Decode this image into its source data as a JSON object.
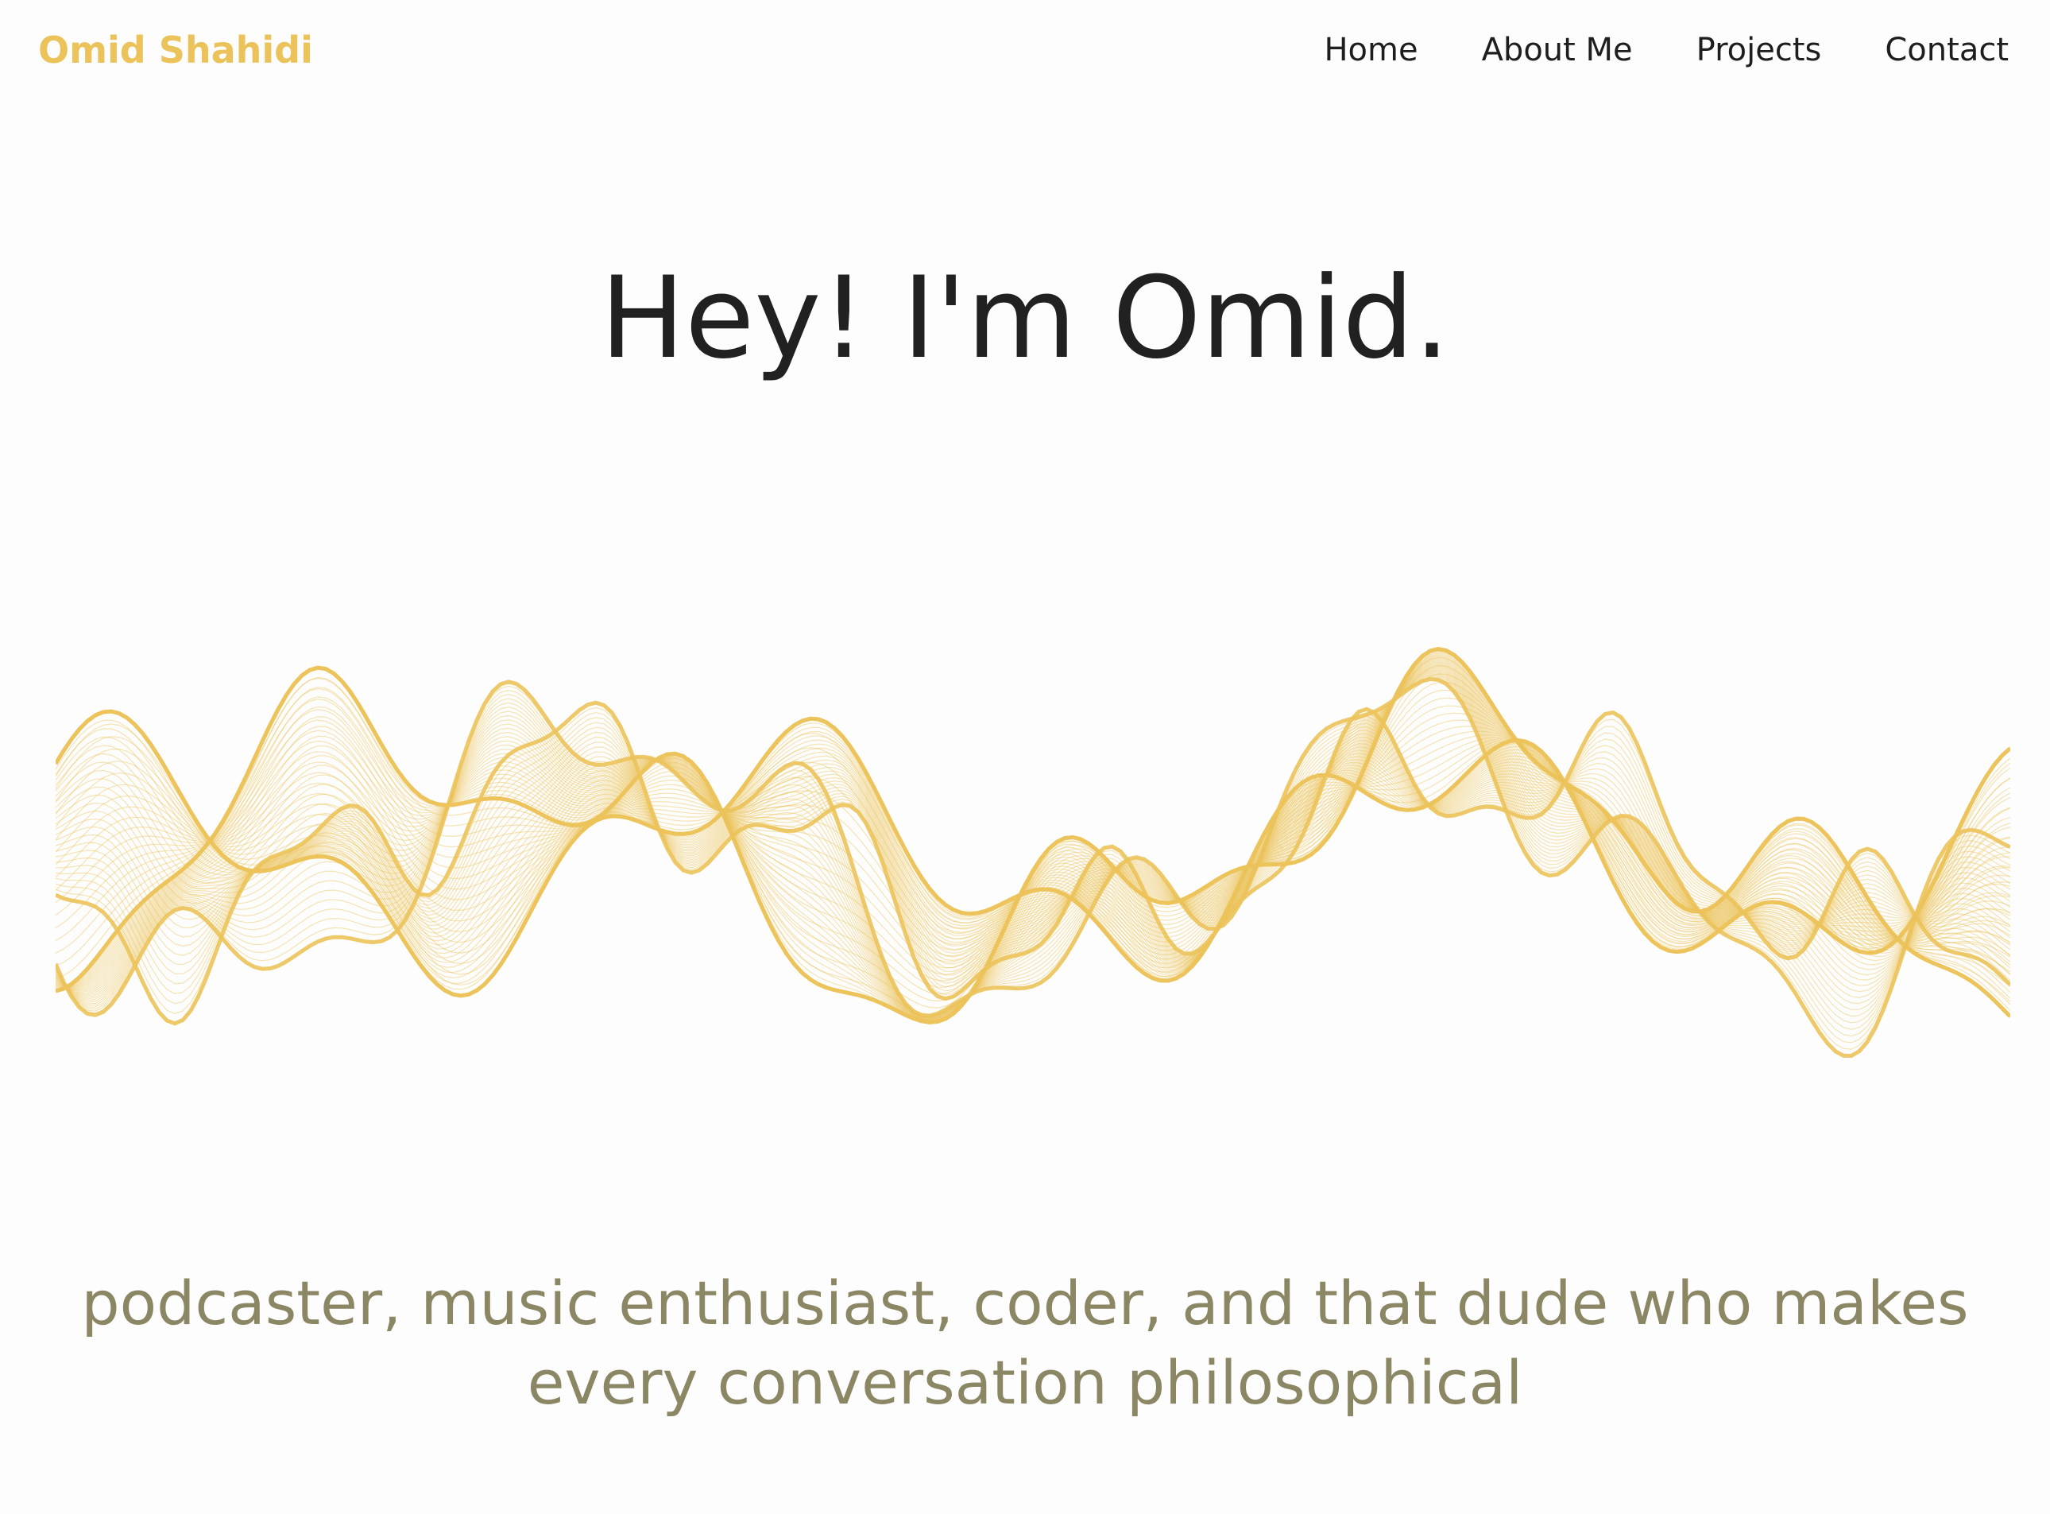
{
  "header": {
    "brand": "Omid Shahidi",
    "nav": [
      {
        "label": "Home"
      },
      {
        "label": "About Me"
      },
      {
        "label": "Projects"
      },
      {
        "label": "Contact"
      }
    ]
  },
  "hero": {
    "title": "Hey! I'm Omid.",
    "tagline_line1": "podcaster, music enthusiast, coder, and that dude who makes",
    "tagline_line2": "every conversation philosophical"
  },
  "colors": {
    "accent": "#ecc35a",
    "text": "#212121",
    "tagline": "#8b8765",
    "background": "#fdfdfd"
  }
}
